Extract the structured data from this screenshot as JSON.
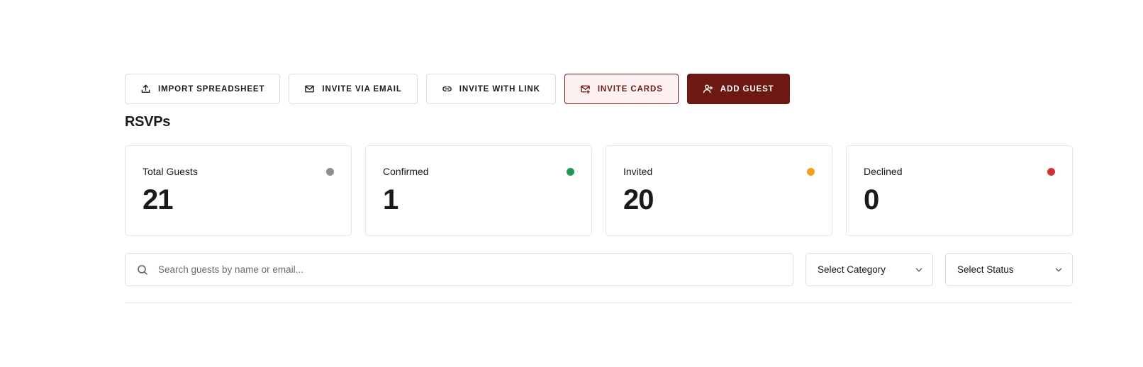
{
  "toolbar": {
    "import_label": "IMPORT SPREADSHEET",
    "email_label": "INVITE VIA EMAIL",
    "link_label": "INVITE WITH LINK",
    "cards_label": "INVITE CARDS",
    "add_label": "ADD GUEST",
    "icons": {
      "import": "upload-icon",
      "email": "mail-icon",
      "link": "link-icon",
      "cards": "mail-plus-icon",
      "add": "user-plus-icon"
    }
  },
  "section_title": "RSVPs",
  "stats": [
    {
      "label": "Total Guests",
      "value": "21",
      "color": "#8e8e8e"
    },
    {
      "label": "Confirmed",
      "value": "1",
      "color": "#1e9a55"
    },
    {
      "label": "Invited",
      "value": "20",
      "color": "#f0a01a"
    },
    {
      "label": "Declined",
      "value": "0",
      "color": "#d5303a"
    }
  ],
  "filters": {
    "search_placeholder": "Search guests by name or email...",
    "search_value": "",
    "category_selected": "Select Category",
    "status_selected": "Select Status"
  },
  "colors": {
    "brand": "#6e1814",
    "brand_tint": "#fdf1f1"
  }
}
